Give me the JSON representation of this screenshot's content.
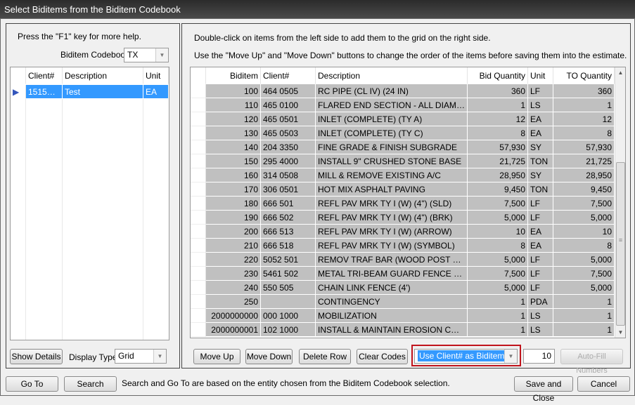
{
  "window": {
    "title": "Select Biditems from the Biditem Codebook"
  },
  "left": {
    "help": "Press the \"F1\" key for more help.",
    "codebook_label": "Biditem Codebook",
    "codebook_value": "TX",
    "columns": [
      "Client#",
      "Description",
      "Unit"
    ],
    "rows": [
      {
        "client": "15151 1...",
        "description": "Test",
        "unit": "EA"
      }
    ],
    "show_details": "Show Details",
    "display_type_label": "Display Type",
    "display_type_value": "Grid"
  },
  "right": {
    "instruction1": "Double-click on items from the left side to add them to the grid on the right side.",
    "instruction2": "Use the \"Move Up\" and \"Move Down\" buttons to change the order of the items before saving them into the estimate.",
    "columns": [
      "Biditem",
      "Client#",
      "Description",
      "Bid Quantity",
      "Unit",
      "TO Quantity"
    ],
    "rows": [
      [
        "100",
        "464 0505",
        "RC PIPE (CL IV) (24 IN)",
        "360",
        "LF",
        "360"
      ],
      [
        "110",
        "465 0100",
        "FLARED END SECTION - ALL DIAMETE...",
        "1",
        "LS",
        "1"
      ],
      [
        "120",
        "465 0501",
        "INLET (COMPLETE) (TY A)",
        "12",
        "EA",
        "12"
      ],
      [
        "130",
        "465 0503",
        "INLET (COMPLETE) (TY C)",
        "8",
        "EA",
        "8"
      ],
      [
        "140",
        "204 3350",
        "FINE GRADE & FINISH SUBGRADE",
        "57,930",
        "SY",
        "57,930"
      ],
      [
        "150",
        "295 4000",
        "INSTALL 9\" CRUSHED STONE BASE",
        "21,725",
        "TON",
        "21,725"
      ],
      [
        "160",
        "314 0508",
        "MILL & REMOVE EXISTING A/C",
        "28,950",
        "SY",
        "28,950"
      ],
      [
        "170",
        "306 0501",
        "HOT MIX ASPHALT PAVING",
        "9,450",
        "TON",
        "9,450"
      ],
      [
        "180",
        "666  501",
        "REFL PAV MRK TY I (W) (4\") (SLD)",
        "7,500",
        "LF",
        "7,500"
      ],
      [
        "190",
        "666  502",
        "REFL PAV MRK TY I (W) (4\") (BRK)",
        "5,000",
        "LF",
        "5,000"
      ],
      [
        "200",
        "666  513",
        "REFL PAV MRK TY I (W) (ARROW)",
        "10",
        "EA",
        "10"
      ],
      [
        "210",
        "666  518",
        "REFL PAV MRK TY I (W) (SYMBOL)",
        "8",
        "EA",
        "8"
      ],
      [
        "220",
        "5052 501",
        "REMOV TRAF BAR (WOOD POST & C...",
        "5,000",
        "LF",
        "5,000"
      ],
      [
        "230",
        "5461 502",
        "METAL TRI-BEAM GUARD FENCE (12 ...",
        "7,500",
        "LF",
        "7,500"
      ],
      [
        "240",
        "550  505",
        "CHAIN LINK FENCE (4')",
        "5,000",
        "LF",
        "5,000"
      ],
      [
        "250",
        "",
        "CONTINGENCY",
        "1",
        "PDA",
        "1"
      ],
      [
        "2000000000",
        "000 1000",
        "MOBILIZATION",
        "1",
        "LS",
        "1"
      ],
      [
        "2000000001",
        "102 1000",
        "INSTALL & MAINTAIN EROSION CON...",
        "1",
        "LS",
        "1"
      ]
    ],
    "move_up": "Move Up",
    "move_down": "Move Down",
    "delete_row": "Delete Row",
    "clear_codes": "Clear Codes",
    "biditem_mode": "Use Client# as Biditem:",
    "increment": "10",
    "auto_fill": "Auto-Fill Numbers"
  },
  "footer": {
    "go_to": "Go To",
    "search": "Search",
    "note": "Search and Go To are based on the entity chosen from the Biditem Codebook selection.",
    "save_close": "Save and Close",
    "cancel": "Cancel"
  },
  "colors": {
    "highlight": "#3399ff",
    "grid_row": "#c0c0c0",
    "focus_box": "#c0141c"
  }
}
